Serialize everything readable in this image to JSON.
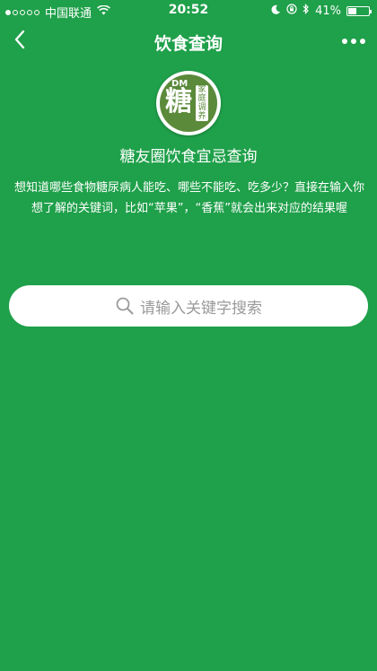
{
  "status_bar": {
    "carrier": "中国联通",
    "time": "20:52",
    "battery_percent": "41%",
    "battery_level": 0.41
  },
  "nav": {
    "title": "饮食查询"
  },
  "logo": {
    "dm_text": "DM",
    "main_char": "糖",
    "side_text": "家庭调养"
  },
  "header": {
    "subtitle": "糖友圈饮食宜忌查询",
    "description": "想知道哪些食物糖尿病人能吃、哪些不能吃、吃多少？直接在输入你想了解的关键词，比如“苹果”，“香蕉”就会出来对应的结果喔"
  },
  "search": {
    "placeholder": "请输入关键字搜索",
    "icon": "search-icon"
  },
  "colors": {
    "background": "#1fa04a",
    "logo_green": "#5a8a3a",
    "placeholder": "#9a9a9a"
  }
}
